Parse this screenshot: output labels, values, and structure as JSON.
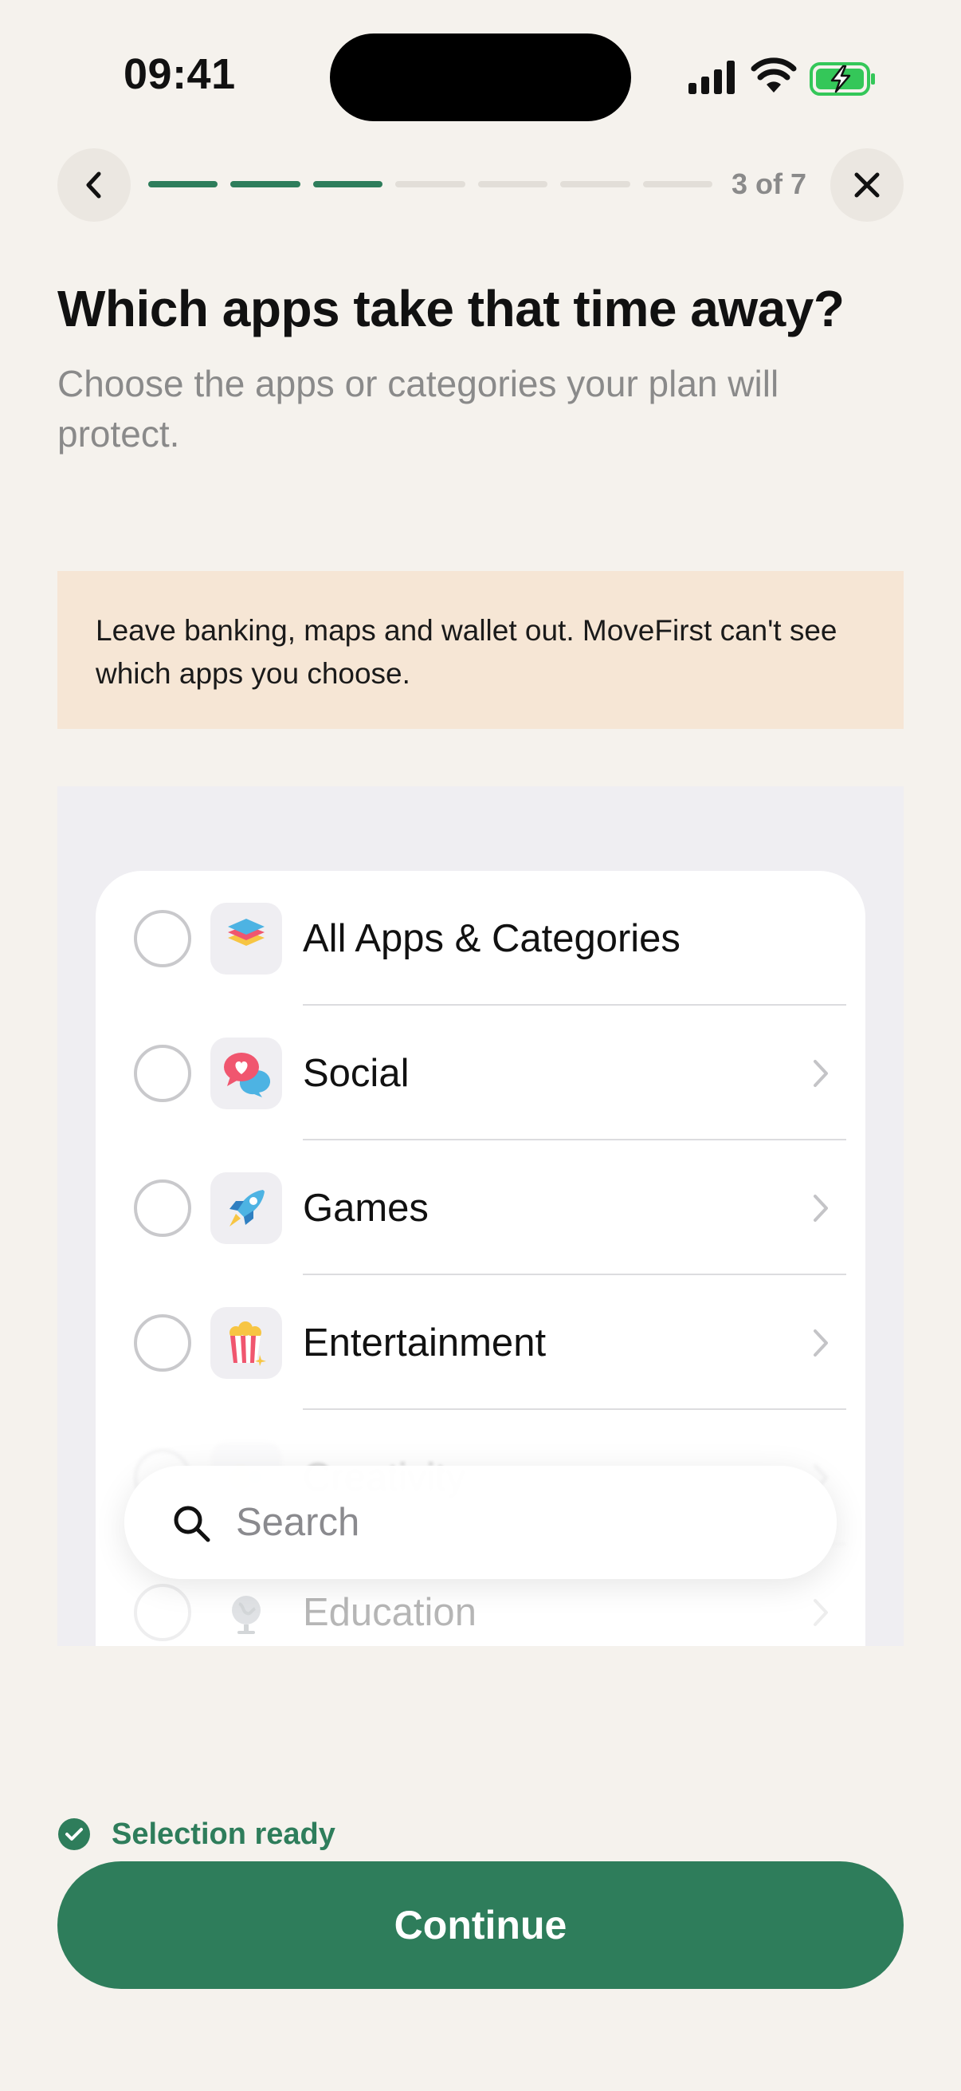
{
  "status_bar": {
    "time": "09:41"
  },
  "nav": {
    "progress": {
      "current": 3,
      "total": 7,
      "label": "3 of 7"
    }
  },
  "header": {
    "title": "Which apps take that time away?",
    "subtitle": "Choose the apps or categories your plan will protect."
  },
  "notice": {
    "text": "Leave banking, maps and wallet out. MoveFirst can't see which apps you choose."
  },
  "picker": {
    "items": [
      {
        "label": "All Apps & Categories",
        "icon": "stack-icon",
        "has_chevron": false
      },
      {
        "label": "Social",
        "icon": "chat-bubble-heart-icon",
        "has_chevron": true
      },
      {
        "label": "Games",
        "icon": "rocket-icon",
        "has_chevron": true
      },
      {
        "label": "Entertainment",
        "icon": "popcorn-icon",
        "has_chevron": true
      },
      {
        "label": "Creativity",
        "icon": "palette-icon",
        "has_chevron": true
      },
      {
        "label": "Education",
        "icon": "globe-icon",
        "has_chevron": true
      }
    ],
    "search_placeholder": "Search"
  },
  "footer": {
    "status": "Selection ready",
    "continue_label": "Continue"
  },
  "colors": {
    "background": "#f5f2ed",
    "accent": "#2e7d5b",
    "notice_bg": "#f6e6d5"
  }
}
